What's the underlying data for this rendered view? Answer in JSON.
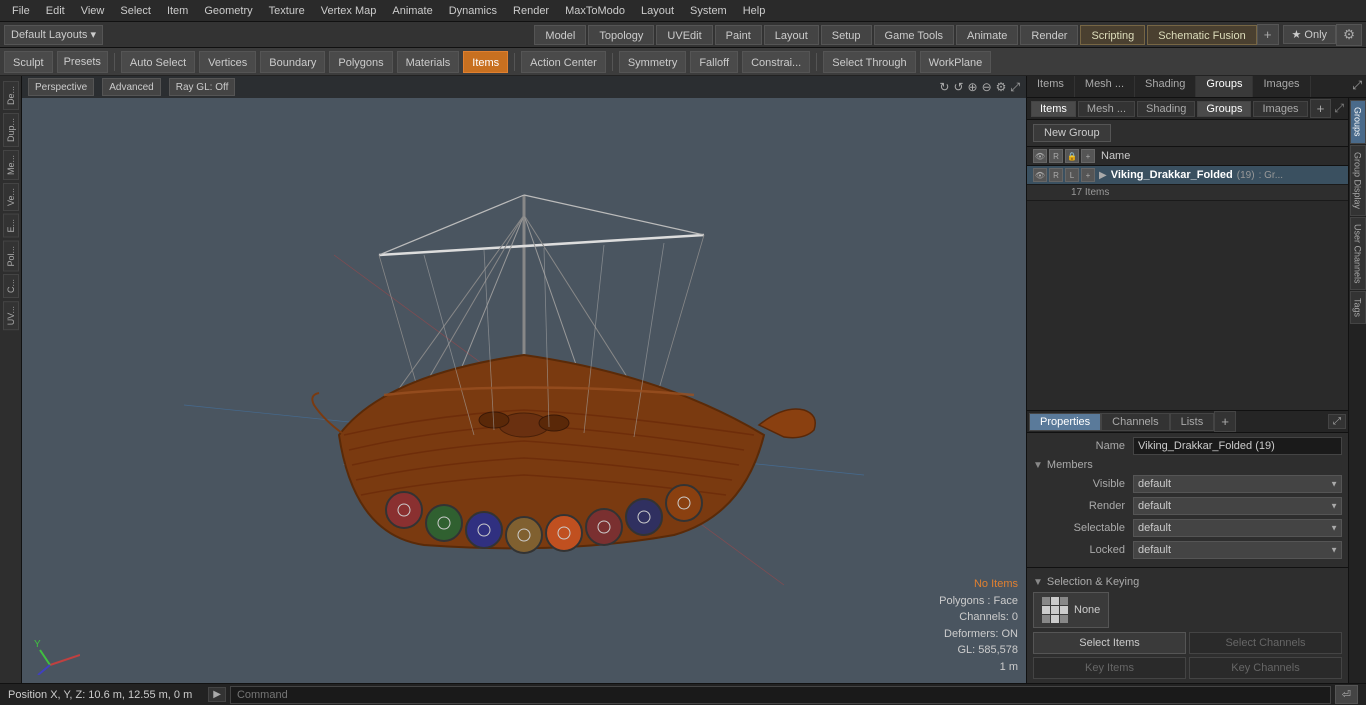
{
  "menus": {
    "items": [
      "File",
      "Edit",
      "View",
      "Select",
      "Item",
      "Geometry",
      "Texture",
      "Vertex Map",
      "Animate",
      "Dynamics",
      "Render",
      "MaxToModo",
      "Layout",
      "System",
      "Help"
    ]
  },
  "layout": {
    "dropdown": "Default Layouts ▾",
    "tabs": [
      "Model",
      "Topology",
      "UVEdit",
      "Paint",
      "Layout",
      "Setup",
      "Game Tools",
      "Animate",
      "Render",
      "Scripting",
      "Schematic Fusion"
    ],
    "only_label": "★ Only",
    "settings_icon": "⚙"
  },
  "toolbar": {
    "sculpt": "Sculpt",
    "presets": "Presets",
    "auto_select": "Auto Select",
    "vertices": "Vertices",
    "boundary": "Boundary",
    "polygons": "Polygons",
    "materials": "Materials",
    "items": "Items",
    "action_center": "Action Center",
    "symmetry": "Symmetry",
    "falloff": "Falloff",
    "constraints": "Constrai...",
    "select_through": "Select Through",
    "work_plane": "WorkPlane"
  },
  "viewport": {
    "mode": "Perspective",
    "advanced": "Advanced",
    "ray_gl": "Ray GL: Off",
    "status": {
      "no_items": "No Items",
      "polygons": "Polygons : Face",
      "channels": "Channels: 0",
      "deformers": "Deformers: ON",
      "gl": "GL: 585,578",
      "scale": "1 m"
    }
  },
  "left_sidebar": {
    "tabs": [
      "De...",
      "Dup...",
      "Me...",
      "Ve...",
      "E...",
      "Pol...",
      "C...",
      "UV..."
    ]
  },
  "panel": {
    "tabs": [
      "Items",
      "Mesh ...",
      "Shading",
      "Groups",
      "Images"
    ],
    "active_tab": "Groups",
    "new_group_btn": "New Group",
    "name_col": "Name",
    "group_item": {
      "name": "Viking_Drakkar_Folded",
      "count": "(19)",
      "suffix": ": Gr...",
      "subcount": "17 Items"
    }
  },
  "properties": {
    "tabs": [
      "Properties",
      "Channels",
      "Lists"
    ],
    "active_tab": "Properties",
    "name_label": "Name",
    "name_value": "Viking_Drakkar_Folded (19)",
    "members_label": "Members",
    "visible_label": "Visible",
    "visible_value": "default",
    "render_label": "Render",
    "render_value": "default",
    "selectable_label": "Selectable",
    "selectable_value": "default",
    "locked_label": "Locked",
    "locked_value": "default",
    "sel_keying_label": "Selection & Keying",
    "none_label": "None",
    "select_items_label": "Select Items",
    "select_channels_label": "Select Channels",
    "key_items_label": "Key Items",
    "key_channels_label": "Key Channels"
  },
  "right_vtabs": [
    "Groups",
    "Group Display",
    "User Channels",
    "Tags"
  ],
  "status_bar": {
    "position": "Position X, Y, Z:   10.6 m, 12.55 m, 0 m",
    "command_placeholder": "Command"
  }
}
